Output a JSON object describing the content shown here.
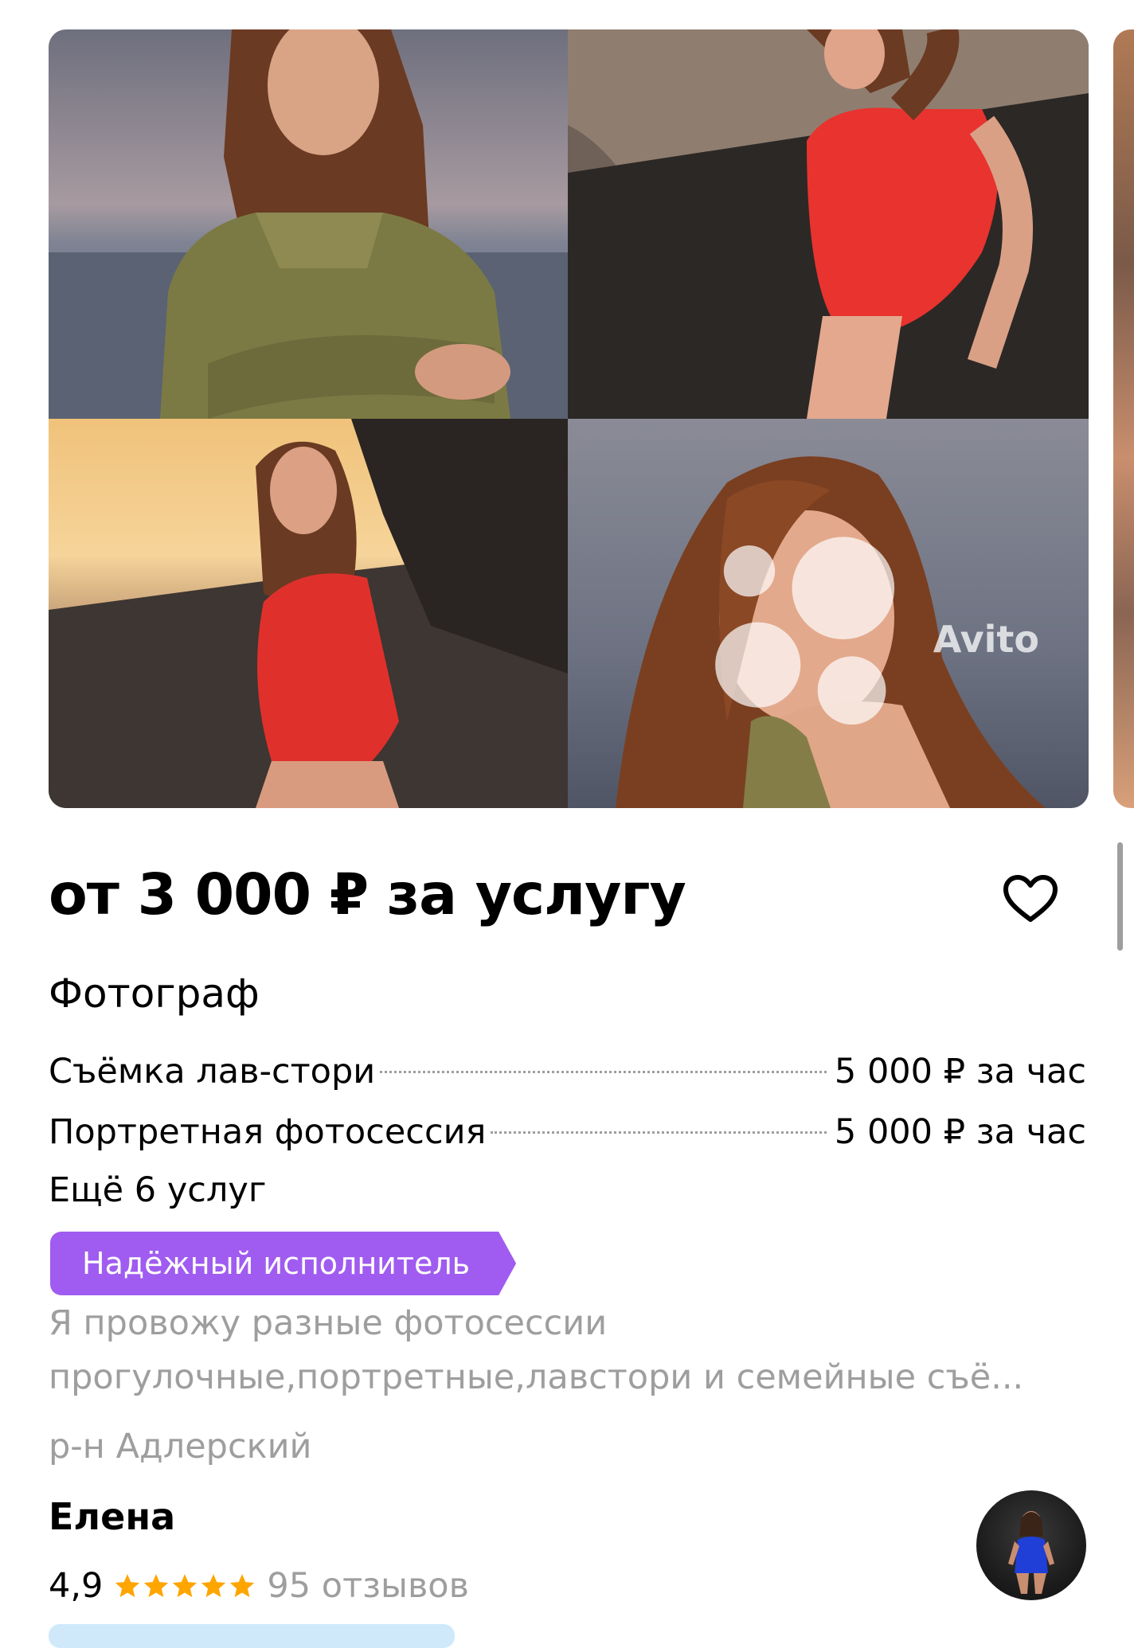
{
  "listing": {
    "price_title": "от 3 000 ₽ за услугу",
    "category": "Фотограф",
    "services": [
      {
        "name": "Съёмка лав-стори",
        "price": "5 000 ₽ за час"
      },
      {
        "name": "Портретная фотосессия",
        "price": "5 000 ₽ за час"
      }
    ],
    "more_services": "Ещё 6 услуг",
    "badge": "Надёжный исполнитель",
    "description_lines": [
      "Я провожу разные фотосессии",
      "прогулочные,портретные,лавстори и семейные съё..."
    ],
    "district": "р-н Адлерский",
    "watermark": "Avito"
  },
  "seller": {
    "name": "Елена",
    "rating": "4,9",
    "stars": 5,
    "reviews": "95 отзывов"
  },
  "colors": {
    "badge": "#a05cf0",
    "stars": "#ffa500",
    "muted_text": "#9e9e9e",
    "text": "#000000"
  },
  "icons": {
    "favorite": "heart-outline-icon",
    "star": "star-icon"
  }
}
